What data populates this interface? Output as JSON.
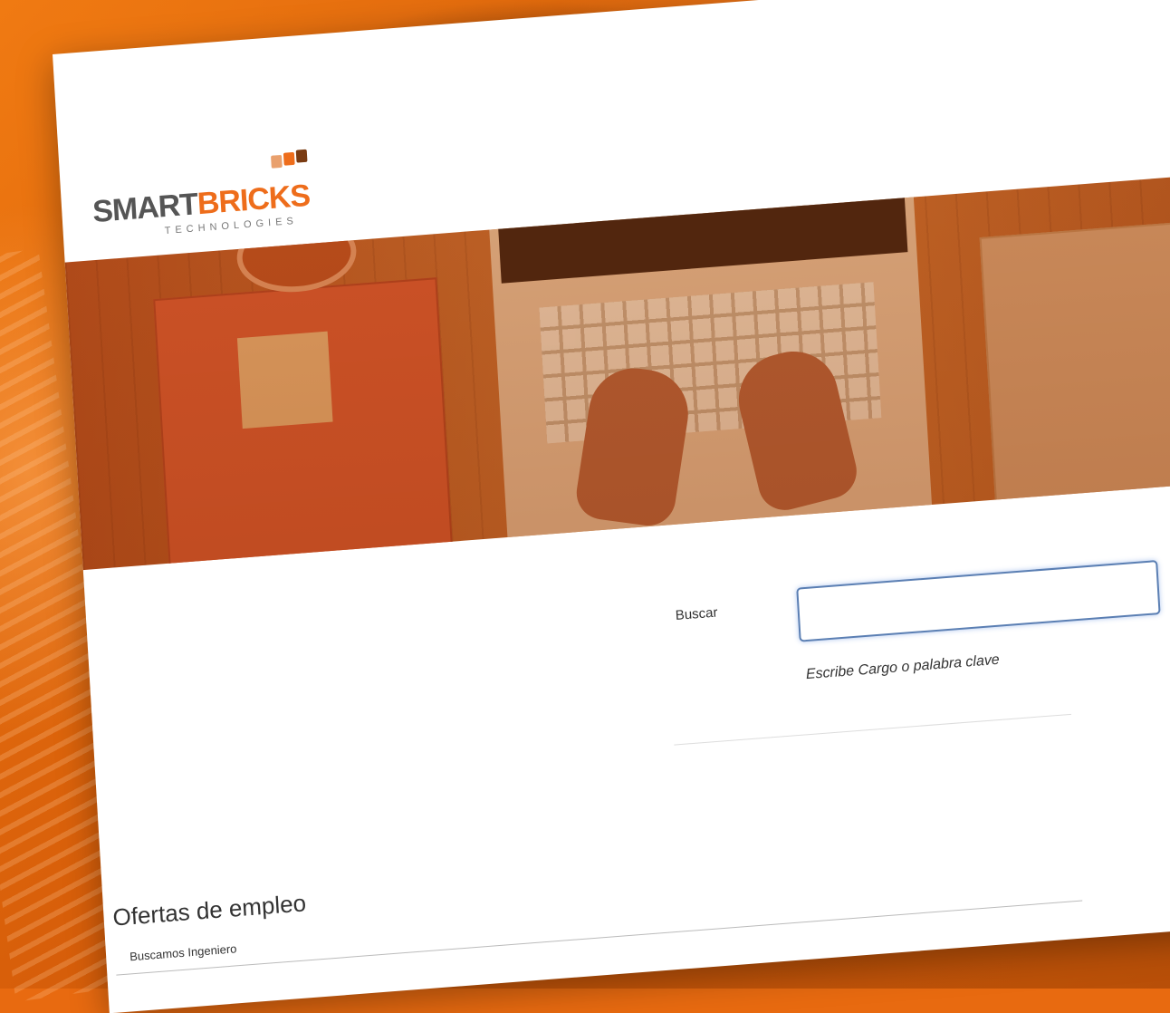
{
  "brand": {
    "name_part1": "SMART",
    "name_part2": "BRICKS",
    "tagline": "TECHNOLOGIES",
    "colors": {
      "orange": "#ee6d1b",
      "gray": "#555555",
      "dark_brown": "#7a3b12"
    }
  },
  "hero": {
    "description_icon": "office-desk-laptop-image"
  },
  "search": {
    "label": "Buscar",
    "value": "",
    "hint": "Escribe Cargo o palabra clave"
  },
  "jobs": {
    "title": "Ofertas de empleo",
    "items": [
      {
        "label": "Buscamos Ingeniero"
      }
    ]
  }
}
